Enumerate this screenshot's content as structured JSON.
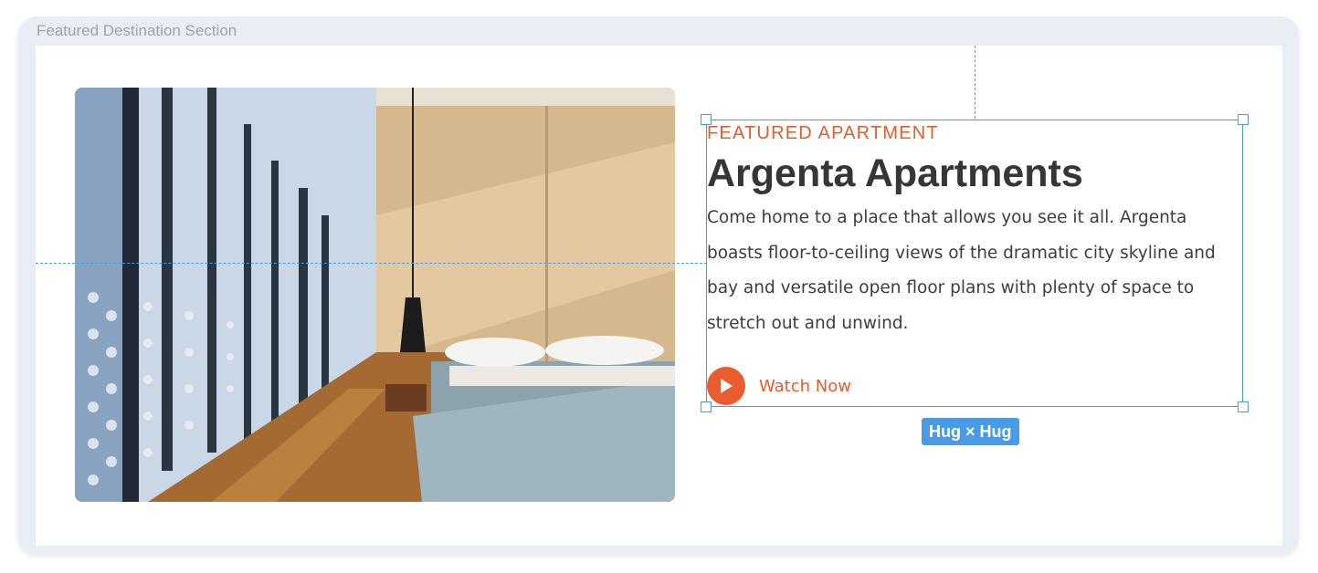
{
  "frame": {
    "label": "Featured Destination Section"
  },
  "hero": {
    "image_alt": "Apartment bedroom with floor-to-ceiling windows",
    "eyebrow": "FEATURED APARTMENT",
    "title": "Argenta Apartments",
    "description": "Come home to a place that allows you see it all. Argenta boasts floor-to-ceiling views of the dramatic city skyline and bay and versatile open floor plans with plenty of space to stretch out and unwind.",
    "cta_label": "Watch Now",
    "cta_icon": "play-icon"
  },
  "selection": {
    "badge": "Hug × Hug"
  },
  "colors": {
    "accent": "#e85c2f",
    "selection": "#4a9be6",
    "heading": "#34363a"
  }
}
